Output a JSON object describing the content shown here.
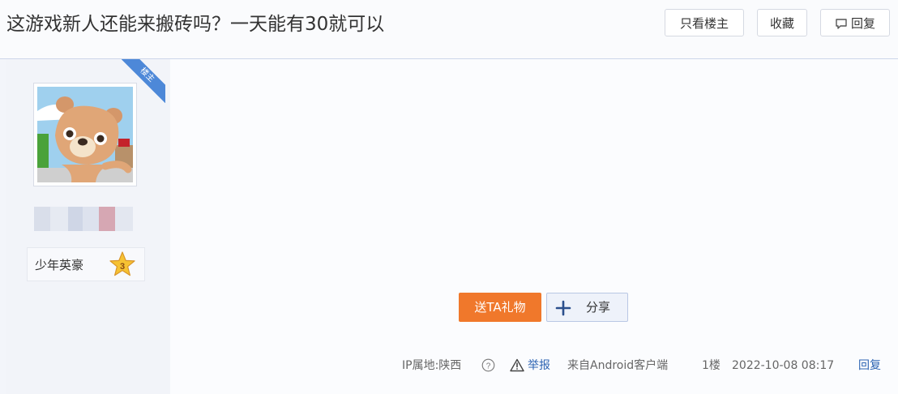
{
  "thread": {
    "title": "这游戏新人还能来搬砖吗？一天能有30就可以"
  },
  "toolbar": {
    "only_op_label": "只看楼主",
    "favorite_label": "收藏",
    "reply_label": "回复"
  },
  "post": {
    "op_badge": "楼主",
    "rank": {
      "label": "少年英豪",
      "level": "3"
    },
    "actions": {
      "gift_label": "送TA礼物",
      "share_label": "分享"
    },
    "footer": {
      "ip_location": "IP属地:陕西",
      "help_icon": "?",
      "report_label": "举报",
      "source": "来自Android客户端",
      "floor": "1楼",
      "datetime": "2022-10-08 08:17",
      "reply_label": "回复"
    }
  },
  "icons": {
    "reply": "speech-bubble-icon",
    "share": "plus-icon",
    "report": "warning-icon",
    "rank": "star-icon"
  },
  "colors": {
    "accent_blue": "#4d88d8",
    "gift_orange": "#f0782b",
    "link_blue": "#2d64b3"
  }
}
